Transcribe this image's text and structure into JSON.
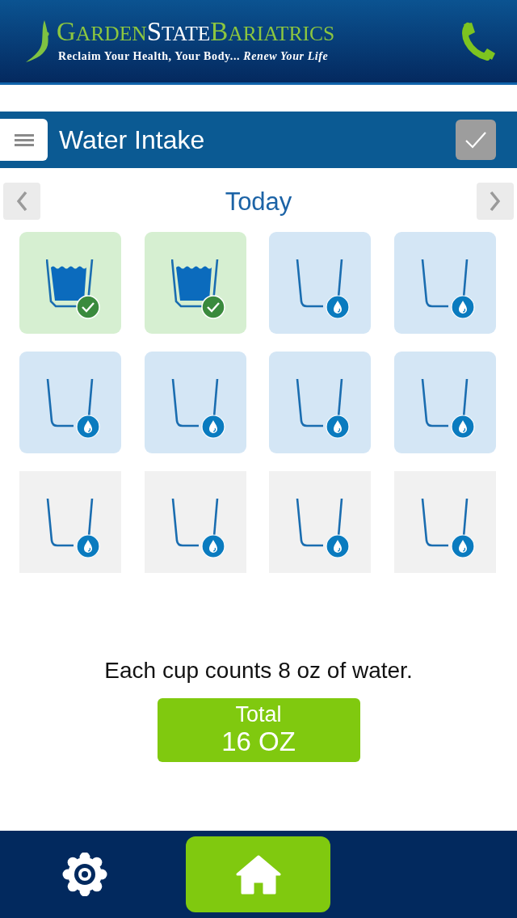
{
  "header": {
    "logo": {
      "wordmark": [
        "GARDEN",
        "STATE",
        "BARIATRICS"
      ],
      "tagline": "Reclaim Your Health, Your Body... *Renew Your Life*"
    }
  },
  "title_bar": {
    "title": "Water Intake"
  },
  "date_nav": {
    "label": "Today"
  },
  "cups": [
    {
      "filled": true,
      "goal": true
    },
    {
      "filled": true,
      "goal": true
    },
    {
      "filled": false,
      "goal": true
    },
    {
      "filled": false,
      "goal": true
    },
    {
      "filled": false,
      "goal": true
    },
    {
      "filled": false,
      "goal": true
    },
    {
      "filled": false,
      "goal": true
    },
    {
      "filled": false,
      "goal": true
    },
    {
      "filled": false,
      "goal": false
    },
    {
      "filled": false,
      "goal": false
    },
    {
      "filled": false,
      "goal": false
    },
    {
      "filled": false,
      "goal": false
    }
  ],
  "note": "Each cup counts 8 oz of water.",
  "total": {
    "label": "Total",
    "value": "16 OZ"
  }
}
